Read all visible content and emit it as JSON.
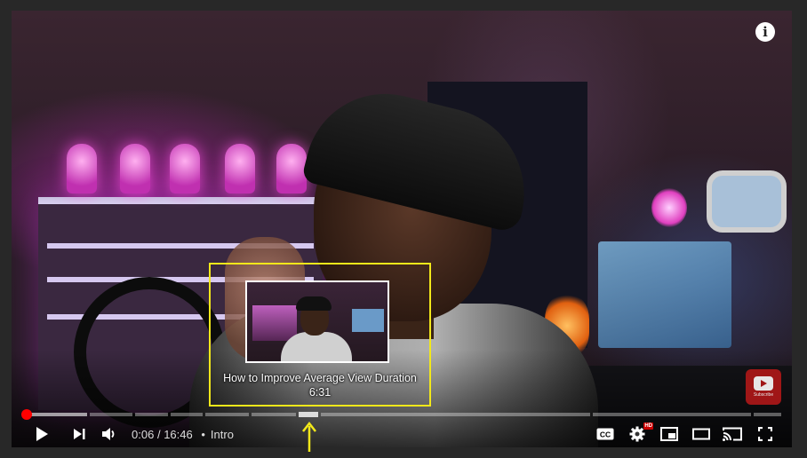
{
  "player": {
    "info_glyph": "i",
    "watermark_text": "Subscribe",
    "preview": {
      "chapter_title": "How to Improve Average View Duration",
      "time": "6:31"
    },
    "progress": {
      "played_fraction": 0.006,
      "colors": {
        "played": "#ff0000",
        "annotation": "#f2e81a"
      }
    },
    "time": {
      "current": "0:06",
      "separator": "/",
      "duration": "16:46",
      "bullet": "•",
      "chapter": "Intro"
    },
    "settings_badge": "HD",
    "icons": [
      "play-icon",
      "next-icon",
      "volume-icon",
      "cc-icon",
      "settings-icon",
      "miniplayer-icon",
      "theater-icon",
      "cast-icon",
      "fullscreen-icon",
      "info-icon"
    ]
  }
}
